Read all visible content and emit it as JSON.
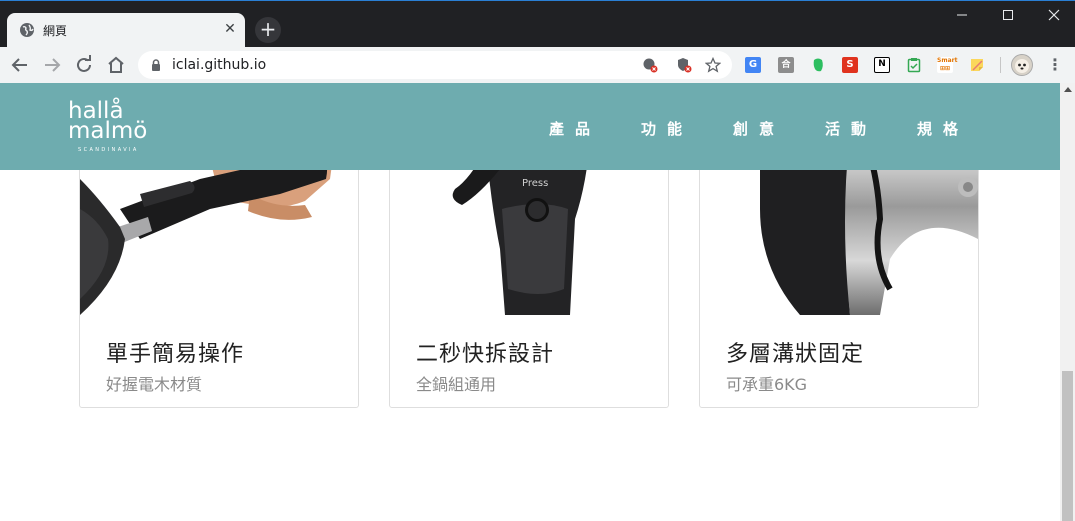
{
  "browser": {
    "tab_title": "網頁",
    "tab_close": "✕",
    "new_tab": "+",
    "url": "iclai.github.io",
    "window_buttons": {
      "minimize": "—",
      "maximize": "☐",
      "close": "✕"
    },
    "extensions": [
      "google-translate",
      "gray-box",
      "evernote",
      "s-extension",
      "notion",
      "green-clipboard",
      "smart-extension",
      "sticky-note"
    ],
    "menu": "⋮"
  },
  "site": {
    "logo": {
      "line1": "hallå",
      "line2": "malmö",
      "line3": "SCANDINAVIA"
    },
    "nav": [
      "產品",
      "功能",
      "創意",
      "活動",
      "規格"
    ],
    "brand_color": "#6eacaf"
  },
  "cards": [
    {
      "title": "單手簡易操作",
      "subtitle": "好握電木材質"
    },
    {
      "title": "二秒快拆設計",
      "subtitle": "全鍋組通用",
      "image_text": "Press"
    },
    {
      "title": "多層溝狀固定",
      "subtitle": "可承重6KG"
    }
  ]
}
